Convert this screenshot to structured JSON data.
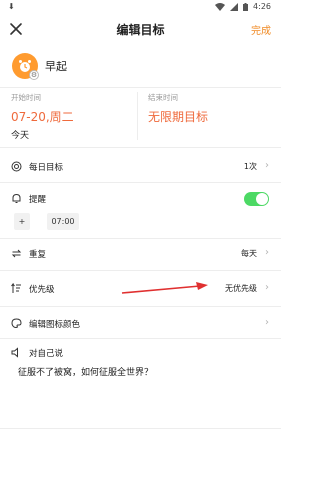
{
  "status_bar": {
    "time": "4:26"
  },
  "nav": {
    "title": "编辑目标",
    "done_label": "完成"
  },
  "goal": {
    "name": "早起"
  },
  "dates": {
    "start_label": "开始时间",
    "start_value": "07-20,周二",
    "start_sub": "今天",
    "end_label": "结束时间",
    "end_value": "无限期目标"
  },
  "daily_goal": {
    "label": "每日目标",
    "value": "1次"
  },
  "reminder": {
    "label": "提醒",
    "enabled": true,
    "add_label": "+",
    "time": "07:00"
  },
  "repeat": {
    "label": "重复",
    "value": "每天"
  },
  "priority": {
    "label": "优先级",
    "value": "无优先级"
  },
  "icon_color": {
    "label": "编辑图标颜色"
  },
  "self_talk": {
    "label": "对自己说",
    "text": "征服不了被窝，如何征服全世界？"
  },
  "colors": {
    "accent": "#f08a24",
    "date": "#ef6a3c",
    "toggle": "#4cd964",
    "arrow": "#e03030"
  }
}
